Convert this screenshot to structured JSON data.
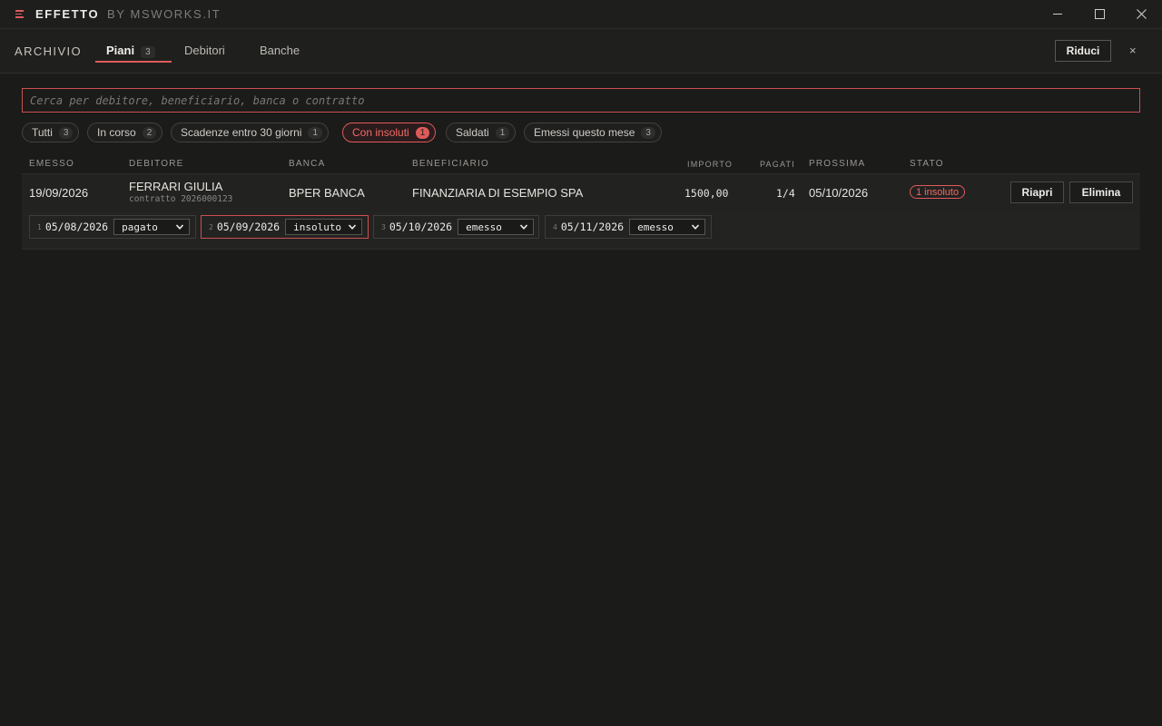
{
  "app": {
    "title": "EFFETTO",
    "subtitle": "BY MSWORKS.IT"
  },
  "nav": {
    "section": "ARCHIVIO",
    "tabs": [
      {
        "label": "Piani",
        "count": "3",
        "active": true
      },
      {
        "label": "Debitori"
      },
      {
        "label": "Banche"
      }
    ],
    "riduci": "Riduci",
    "close": "×"
  },
  "search": {
    "placeholder": "Cerca per debitore, beneficiario, banca o contratto",
    "value": ""
  },
  "filters": [
    {
      "label": "Tutti",
      "count": "3"
    },
    {
      "label": "In corso",
      "count": "2"
    },
    {
      "label": "Scadenze entro 30 giorni",
      "count": "1"
    },
    {
      "label": "Con insoluti",
      "count": "1",
      "active": true
    },
    {
      "label": "Saldati",
      "count": "1"
    },
    {
      "label": "Emessi questo mese",
      "count": "3"
    }
  ],
  "table": {
    "headers": {
      "emesso": "EMESSO",
      "debitore": "DEBITORE",
      "banca": "BANCA",
      "beneficiario": "BENEFICIARIO",
      "importo": "IMPORTO",
      "pagati": "PAGATI",
      "prossima": "PROSSIMA",
      "stato": "STATO"
    },
    "rows": [
      {
        "emesso": "19/09/2026",
        "debitore": "FERRARI GIULIA",
        "contratto": "contratto 2026000123",
        "banca": "BPER BANCA",
        "beneficiario": "FINANZIARIA DI ESEMPIO SPA",
        "importo": "1500,00",
        "pagati": "1/4",
        "prossima": "05/10/2026",
        "stato": "1 insoluto",
        "actions": {
          "riapri": "Riapri",
          "elimina": "Elimina"
        },
        "installments": [
          {
            "n": "1",
            "date": "05/08/2026",
            "status": "pagato"
          },
          {
            "n": "2",
            "date": "05/09/2026",
            "status": "insoluto",
            "warn": true
          },
          {
            "n": "3",
            "date": "05/10/2026",
            "status": "emesso"
          },
          {
            "n": "4",
            "date": "05/11/2026",
            "status": "emesso"
          }
        ]
      }
    ]
  },
  "colors": {
    "accent": "#e05a5a",
    "background": "#1b1b1a"
  }
}
